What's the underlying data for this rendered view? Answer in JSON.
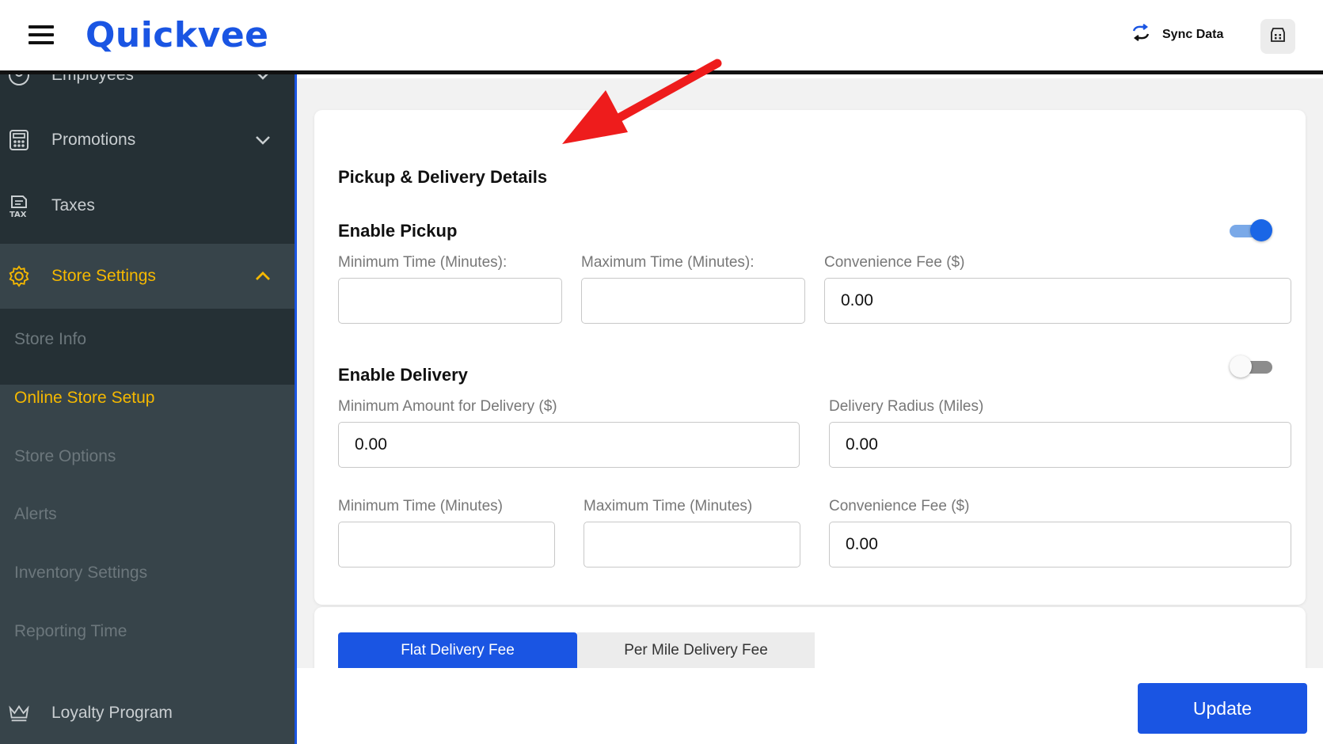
{
  "header": {
    "logo_text": "Quickvee",
    "sync_label": "Sync Data"
  },
  "sidebar": {
    "items": [
      {
        "label": "Employees",
        "icon": "user-circle-icon"
      },
      {
        "label": "Promotions",
        "icon": "calculator-icon"
      },
      {
        "label": "Taxes",
        "icon": "tax-icon"
      },
      {
        "label": "Store Settings",
        "icon": "gear-icon"
      },
      {
        "label": "Loyalty Program",
        "icon": "crown-icon"
      }
    ],
    "sub_items": [
      {
        "label": "Store Info"
      },
      {
        "label": "Online Store Setup"
      },
      {
        "label": "Store Options"
      },
      {
        "label": "Alerts"
      },
      {
        "label": "Inventory Settings"
      },
      {
        "label": "Reporting Time"
      }
    ]
  },
  "pickup_delivery": {
    "title": "Pickup & Delivery Details",
    "pickup": {
      "title": "Enable Pickup",
      "enabled": true,
      "min_time_label": "Minimum Time (Minutes):",
      "min_time_value": "",
      "max_time_label": "Maximum Time (Minutes):",
      "max_time_value": "",
      "fee_label": "Convenience Fee ($)",
      "fee_value": "0.00"
    },
    "delivery": {
      "title": "Enable Delivery",
      "enabled": false,
      "min_amount_label": "Minimum Amount for Delivery ($)",
      "min_amount_value": "0.00",
      "radius_label": "Delivery Radius (Miles)",
      "radius_value": "0.00",
      "min_time_label": "Minimum Time (Minutes)",
      "min_time_value": "",
      "max_time_label": "Maximum Time (Minutes)",
      "max_time_value": "",
      "fee_label": "Convenience Fee ($)",
      "fee_value": "0.00"
    }
  },
  "fee_tabs": [
    {
      "label": "Flat Delivery Fee",
      "active": true
    },
    {
      "label": "Per Mile Delivery Fee",
      "active": false
    }
  ],
  "footer": {
    "update_label": "Update"
  },
  "colors": {
    "accent": "#1a55e3",
    "sidebar_bg": "#253035",
    "sidebar_active": "#37444a",
    "highlight": "#f5b800",
    "annotation_arrow": "#ee1c1c"
  }
}
